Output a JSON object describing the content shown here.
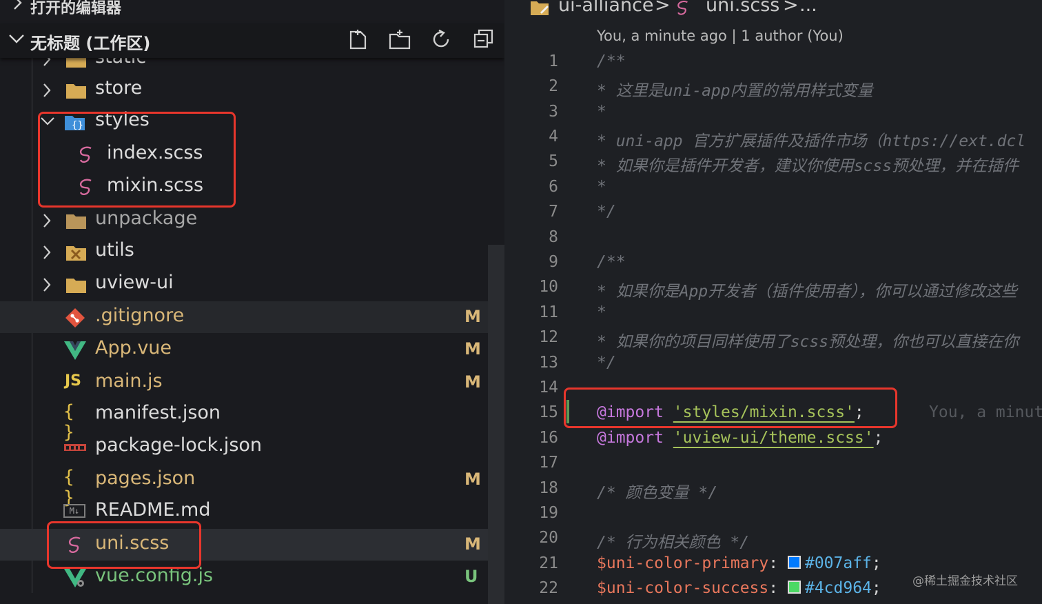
{
  "explorer": {
    "open_editors_title": "打开的编辑器",
    "workspace_title": "无标题 (工作区)",
    "toolbar": [
      "new-file-icon",
      "new-folder-icon",
      "refresh-icon",
      "collapse-all-icon"
    ],
    "items": {
      "static": "static",
      "store": "store",
      "styles": "styles",
      "index_scss": "index.scss",
      "mixin_scss": "mixin.scss",
      "unpackage": "unpackage",
      "utils": "utils",
      "uview_ui": "uview-ui",
      "gitignore": ".gitignore",
      "app_vue": "App.vue",
      "main_js": "main.js",
      "manifest_json": "manifest.json",
      "package_lock": "package-lock.json",
      "pages_json": "pages.json",
      "readme": "README.md",
      "uni_scss": "uni.scss",
      "vue_config": "vue.config.js"
    },
    "badges": {
      "modified": "M",
      "untracked": "U"
    },
    "icons": {
      "js": "JS",
      "json": "{ }",
      "md": "M↓"
    }
  },
  "editor": {
    "breadcrumb": {
      "root": "ui-alliance",
      "sep": ">",
      "file": "uni.scss",
      "more": "..."
    },
    "blame": "You, a minute ago | 1 author (You)",
    "ghost_blame": "You, a minut",
    "lines": {
      "l1": "/**",
      "l2": " * 这里是uni-app内置的常用样式变量",
      "l3": " *",
      "l4": " * uni-app 官方扩展插件及插件市场（https://ext.dcl",
      "l5": " * 如果你是插件开发者，建议你使用scss预处理，并在插件",
      "l6": " *",
      "l7": " */",
      "l9": "/**",
      "l10": " * 如果你是App开发者（插件使用者），你可以通过修改这些",
      "l11": " *",
      "l12": " * 如果你的项目同样使用了scss预处理，你也可以直接在你",
      "l13": " */",
      "import_kw": "@import",
      "import1": "'styles/mixin.scss'",
      "import2": "'uview-ui/theme.scss'",
      "semi": ";",
      "l18": "/* 颜色变量 */",
      "l20": "/* 行为相关颜色 */",
      "var1": "$uni-color-primary",
      "val1": "#007aff",
      "var2": "$uni-color-success",
      "val2": "#4cd964",
      "colon": ":"
    },
    "line_numbers": [
      "1",
      "2",
      "3",
      "4",
      "5",
      "6",
      "7",
      "8",
      "9",
      "10",
      "11",
      "12",
      "13",
      "14",
      "15",
      "16",
      "17",
      "18",
      "19",
      "20",
      "21",
      "22"
    ],
    "colors": {
      "primary_swatch": "#007aff",
      "success_swatch": "#4cd964"
    }
  },
  "watermark": "@稀土掘金技术社区"
}
